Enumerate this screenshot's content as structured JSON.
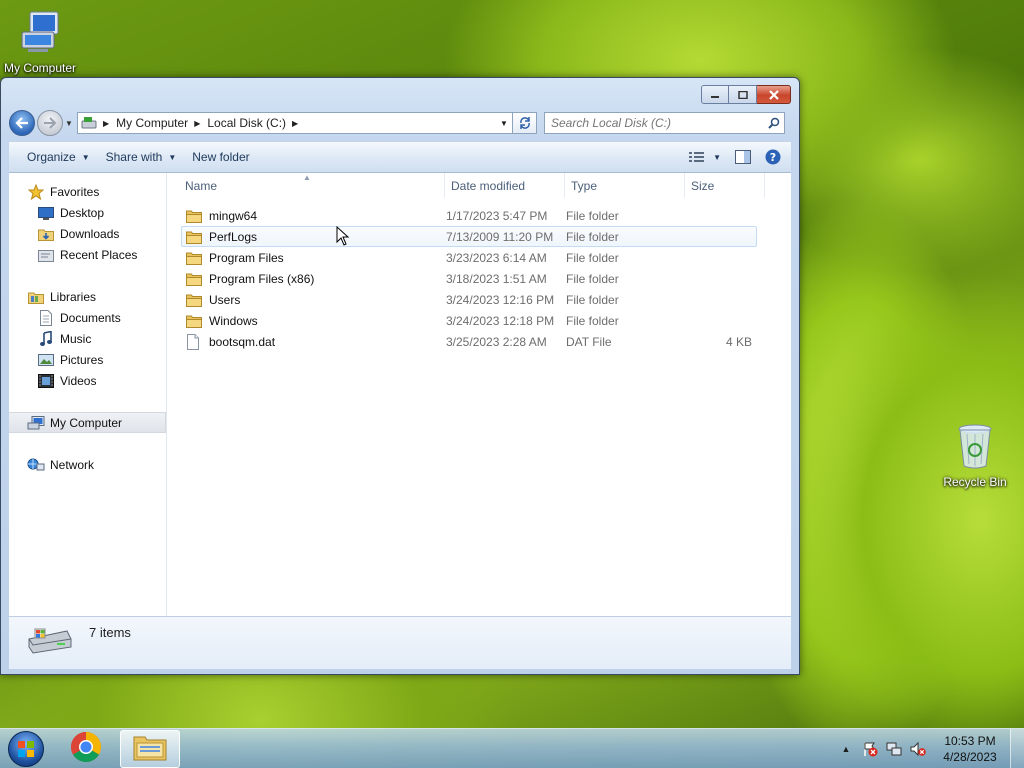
{
  "desktop": {
    "icons": [
      {
        "label": "My Computer"
      },
      {
        "label": "Recycle Bin"
      }
    ]
  },
  "window": {
    "address": {
      "crumbs": [
        "My Computer",
        "Local Disk (C:)"
      ]
    },
    "search": {
      "placeholder": "Search Local Disk (C:)"
    },
    "toolbar": {
      "organize": "Organize",
      "share_with": "Share with",
      "new_folder": "New folder"
    },
    "nav": {
      "favorites": "Favorites",
      "desktop": "Desktop",
      "downloads": "Downloads",
      "recent_places": "Recent Places",
      "libraries": "Libraries",
      "documents": "Documents",
      "music": "Music",
      "pictures": "Pictures",
      "videos": "Videos",
      "my_computer": "My Computer",
      "network": "Network"
    },
    "columns": {
      "name": "Name",
      "date": "Date modified",
      "type": "Type",
      "size": "Size"
    },
    "files": [
      {
        "name": "mingw64",
        "date": "1/17/2023 5:47 PM",
        "type": "File folder",
        "size": "",
        "kind": "folder"
      },
      {
        "name": "PerfLogs",
        "date": "7/13/2009 11:20 PM",
        "type": "File folder",
        "size": "",
        "kind": "folder"
      },
      {
        "name": "Program Files",
        "date": "3/23/2023 6:14 AM",
        "type": "File folder",
        "size": "",
        "kind": "folder"
      },
      {
        "name": "Program Files (x86)",
        "date": "3/18/2023 1:51 AM",
        "type": "File folder",
        "size": "",
        "kind": "folder"
      },
      {
        "name": "Users",
        "date": "3/24/2023 12:16 PM",
        "type": "File folder",
        "size": "",
        "kind": "folder"
      },
      {
        "name": "Windows",
        "date": "3/24/2023 12:18 PM",
        "type": "File folder",
        "size": "",
        "kind": "folder"
      },
      {
        "name": "bootsqm.dat",
        "date": "3/25/2023 2:28 AM",
        "type": "DAT File",
        "size": "4 KB",
        "kind": "file"
      }
    ],
    "status": {
      "item_count": "7 items"
    }
  },
  "taskbar": {
    "clock_time": "10:53 PM",
    "clock_date": "4/28/2023"
  }
}
